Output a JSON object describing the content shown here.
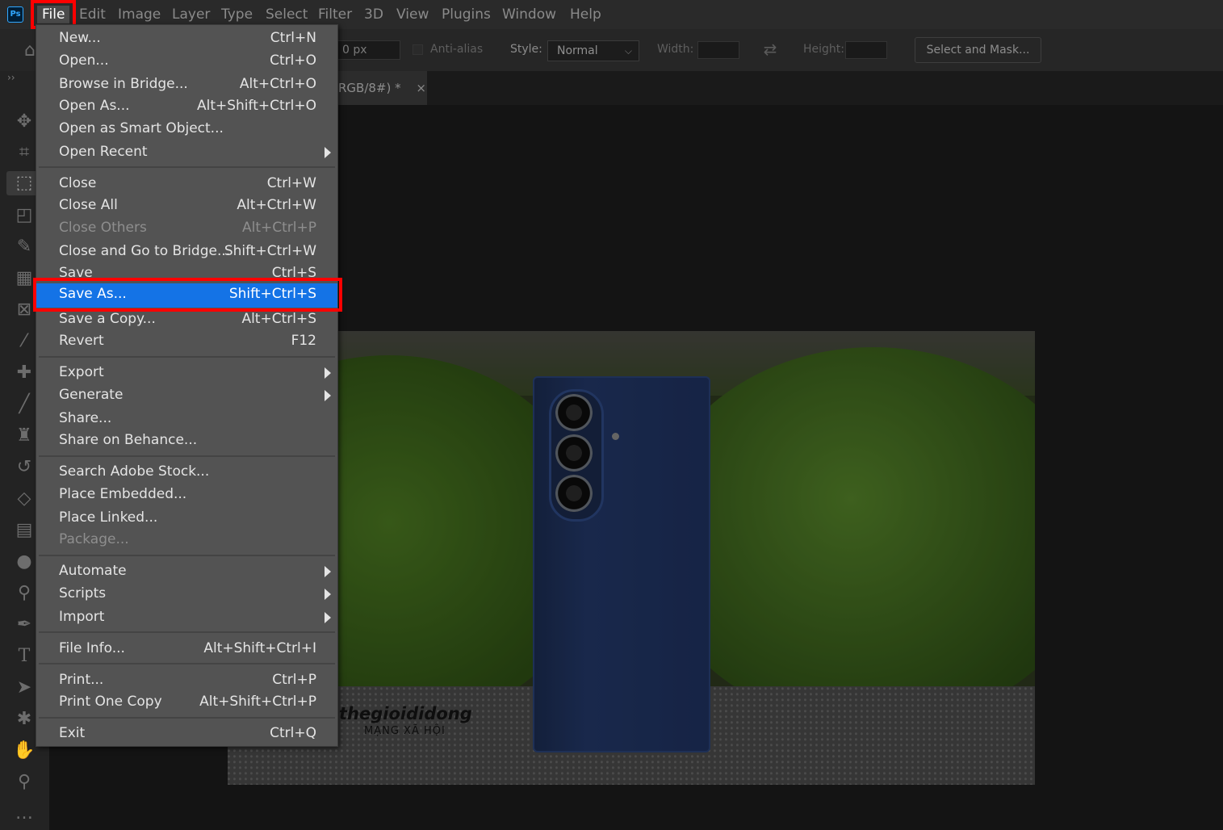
{
  "app": {
    "logo_text": "Ps"
  },
  "menubar": {
    "items": [
      "File",
      "Edit",
      "Image",
      "Layer",
      "Type",
      "Select",
      "Filter",
      "3D",
      "View",
      "Plugins",
      "Window",
      "Help"
    ]
  },
  "options_bar": {
    "feather_value": "0 px",
    "anti_alias_label": "Anti-alias",
    "style_label": "Style:",
    "style_value": "Normal",
    "width_label": "Width:",
    "height_label": "Height:",
    "select_mask_label": "Select and Mask..."
  },
  "document_tab": {
    "title": "RGB/8#) *",
    "close": "×"
  },
  "toolbar": {
    "expand": "››",
    "tools": [
      "move-icon",
      "crop-icon",
      "marquee-icon",
      "perspective-crop-icon",
      "quick-select-icon",
      "frame-icon",
      "frame-x-icon",
      "eyedropper-icon",
      "healing-icon",
      "brush-icon",
      "stamp-icon",
      "history-brush-icon",
      "eraser-icon",
      "gradient-icon",
      "blur-icon",
      "dodge-icon",
      "pen-icon",
      "type-icon",
      "path-select-icon",
      "shape-icon",
      "hand-icon",
      "zoom-icon",
      "more-icon"
    ]
  },
  "file_menu": {
    "items": [
      {
        "label": "New...",
        "shortcut": "Ctrl+N"
      },
      {
        "label": "Open...",
        "shortcut": "Ctrl+O"
      },
      {
        "label": "Browse in Bridge...",
        "shortcut": "Alt+Ctrl+O"
      },
      {
        "label": "Open As...",
        "shortcut": "Alt+Shift+Ctrl+O"
      },
      {
        "label": "Open as Smart Object...",
        "shortcut": ""
      },
      {
        "label": "Open Recent",
        "shortcut": ""
      },
      {
        "label": "Close",
        "shortcut": "Ctrl+W"
      },
      {
        "label": "Close All",
        "shortcut": "Alt+Ctrl+W"
      },
      {
        "label": "Close Others",
        "shortcut": "Alt+Ctrl+P"
      },
      {
        "label": "Close and Go to Bridge...",
        "shortcut": "Shift+Ctrl+W"
      },
      {
        "label": "Save",
        "shortcut": "Ctrl+S"
      },
      {
        "label": "Save As...",
        "shortcut": "Shift+Ctrl+S"
      },
      {
        "label": "Save a Copy...",
        "shortcut": "Alt+Ctrl+S"
      },
      {
        "label": "Revert",
        "shortcut": "F12"
      },
      {
        "label": "Export",
        "shortcut": ""
      },
      {
        "label": "Generate",
        "shortcut": ""
      },
      {
        "label": "Share...",
        "shortcut": ""
      },
      {
        "label": "Share on Behance...",
        "shortcut": ""
      },
      {
        "label": "Search Adobe Stock...",
        "shortcut": ""
      },
      {
        "label": "Place Embedded...",
        "shortcut": ""
      },
      {
        "label": "Place Linked...",
        "shortcut": ""
      },
      {
        "label": "Package...",
        "shortcut": ""
      },
      {
        "label": "Automate",
        "shortcut": ""
      },
      {
        "label": "Scripts",
        "shortcut": ""
      },
      {
        "label": "Import",
        "shortcut": ""
      },
      {
        "label": "File Info...",
        "shortcut": "Alt+Shift+Ctrl+I"
      },
      {
        "label": "Print...",
        "shortcut": "Ctrl+P"
      },
      {
        "label": "Print One Copy",
        "shortcut": "Alt+Shift+Ctrl+P"
      },
      {
        "label": "Exit",
        "shortcut": "Ctrl+Q"
      }
    ]
  },
  "canvas": {
    "watermark": "thegioididong",
    "watermark_sub": "MẠNG XÃ HỘI"
  },
  "colors": {
    "highlight": "#1473e6",
    "annotation": "#ff0000"
  }
}
